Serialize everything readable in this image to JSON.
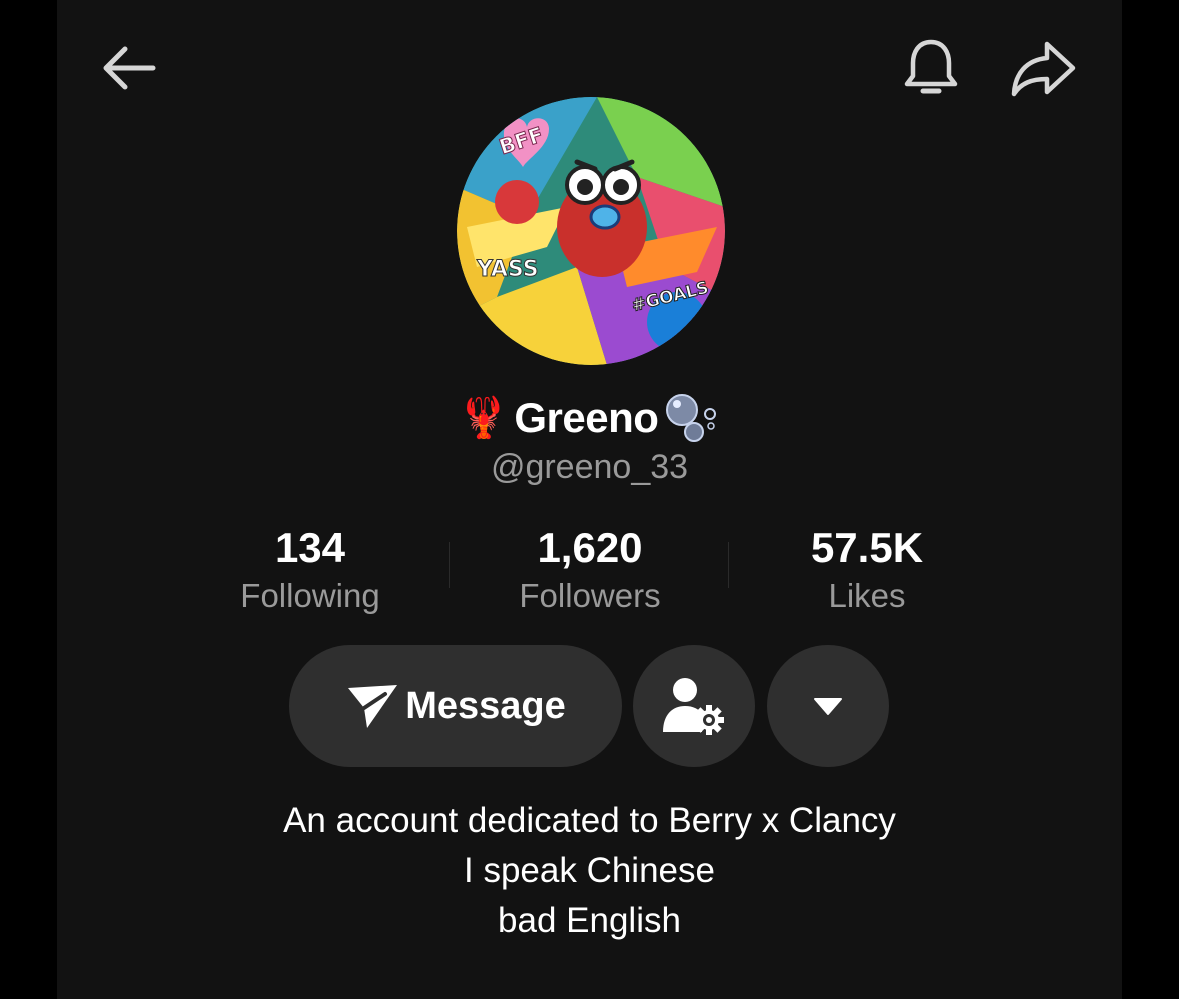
{
  "header": {
    "back_icon": "arrow-left-icon",
    "notification_icon": "bell-icon",
    "share_icon": "share-arrow-icon"
  },
  "profile": {
    "avatar_stickers": [
      "BFF",
      "YASS",
      "#GOALS"
    ],
    "name_prefix_emoji": "🦞",
    "display_name": "Greeno",
    "name_suffix_icon": "bubbles-icon",
    "handle": "@greeno_33"
  },
  "stats": {
    "following": {
      "value": "134",
      "label": "Following"
    },
    "followers": {
      "value": "1,620",
      "label": "Followers"
    },
    "likes": {
      "value": "57.5K",
      "label": "Likes"
    }
  },
  "actions": {
    "message_label": "Message",
    "message_icon": "send-plane-icon",
    "friend_settings_icon": "user-gear-icon",
    "more_icon": "caret-down-icon"
  },
  "bio": {
    "lines": [
      "An account dedicated to Berry x Clancy",
      "I speak Chinese",
      "bad English"
    ]
  },
  "colors": {
    "background": "#121212",
    "button_bg": "#2f2f2f",
    "primary_text": "#ffffff",
    "secondary_text": "#9a9a9a"
  }
}
